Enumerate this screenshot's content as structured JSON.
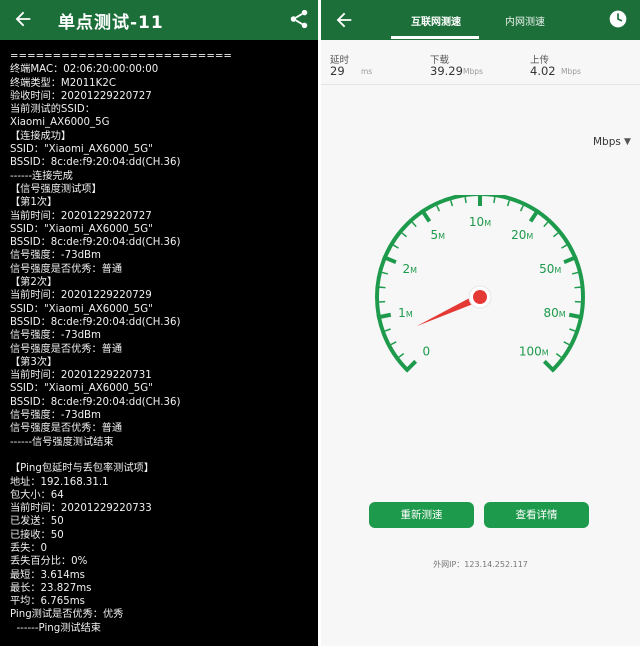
{
  "left": {
    "title": "单点测试-11",
    "log_lines": [
      "==========================",
      "终端MAC：02:06:20:00:00:00",
      "终端类型：M2011K2C",
      "验收时间：20201229220727",
      "当前测试的SSID：",
      "Xiaomi_AX6000_5G",
      "【连接成功】",
      "SSID：\"Xiaomi_AX6000_5G\"",
      "BSSID：8c:de:f9:20:04:dd(CH.36)",
      "------连接完成",
      "【信号强度测试项】",
      "【第1次】",
      "当前时间：20201229220727",
      "SSID：\"Xiaomi_AX6000_5G\"",
      "BSSID：8c:de:f9:20:04:dd(CH.36)",
      "信号强度：-73dBm",
      "信号强度是否优秀：普通",
      "【第2次】",
      "当前时间：20201229220729",
      "SSID：\"Xiaomi_AX6000_5G\"",
      "BSSID：8c:de:f9:20:04:dd(CH.36)",
      "信号强度：-73dBm",
      "信号强度是否优秀：普通",
      "【第3次】",
      "当前时间：20201229220731",
      "SSID：\"Xiaomi_AX6000_5G\"",
      "BSSID：8c:de:f9:20:04:dd(CH.36)",
      "信号强度：-73dBm",
      "信号强度是否优秀：普通",
      "------信号强度测试结束",
      "",
      "【Ping包延时与丢包率测试项】",
      "地址：192.168.31.1",
      "包大小：64",
      "当前时间：20201229220733",
      "已发送：50",
      "已接收：50",
      "丢失：0",
      "丢失百分比：0%",
      "最短：3.614ms",
      "最长：23.827ms",
      "平均：6.765ms",
      "Ping测试是否优秀：优秀",
      "  ------Ping测试结束"
    ]
  },
  "right": {
    "tabs": [
      "互联网测速",
      "内网测速"
    ],
    "stats": [
      {
        "label": "延时",
        "value": "29",
        "unit": "ms"
      },
      {
        "label": "下载",
        "value": "39.29",
        "unit": "Mbps"
      },
      {
        "label": "上传",
        "value": "4.02",
        "unit": "Mbps"
      }
    ],
    "unit_selector": "Mbps",
    "gauge": {
      "ticks": [
        "0",
        "1M",
        "2M",
        "5M",
        "10M",
        "20M",
        "50M",
        "80M",
        "100M"
      ],
      "needle_value_mbps": 0.6
    },
    "buttons": {
      "retest": "重新测速",
      "details": "查看详情"
    },
    "ip_line": "外网IP：123.14.252.117",
    "colors": {
      "primary": "#1d6f3a",
      "button": "#1e9a4c",
      "gauge": "#1e9a4c",
      "needle": "#e53935"
    }
  }
}
